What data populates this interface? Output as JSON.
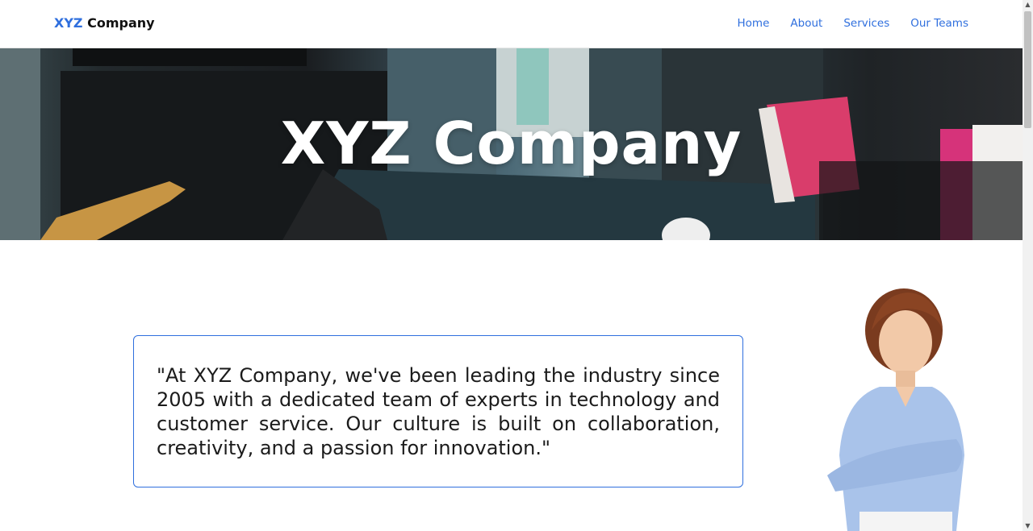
{
  "header": {
    "brand_accent": "XYZ",
    "brand_rest": " Company",
    "nav": [
      {
        "label": "Home"
      },
      {
        "label": "About"
      },
      {
        "label": "Services"
      },
      {
        "label": "Our Teams"
      }
    ]
  },
  "hero": {
    "title": "XYZ Company"
  },
  "quote": {
    "text": "\"At XYZ Company, we've been leading the industry since 2005 with a dedicated team of experts in technology and customer service. Our culture is built on collaboration, creativity, and a passion for innovation.\""
  },
  "colors": {
    "accent": "#2f6fde",
    "text": "#1b1b1b",
    "background": "#ffffff"
  },
  "icons": {
    "scroll_up": "triangle-up-icon",
    "scroll_down": "triangle-down-icon"
  }
}
